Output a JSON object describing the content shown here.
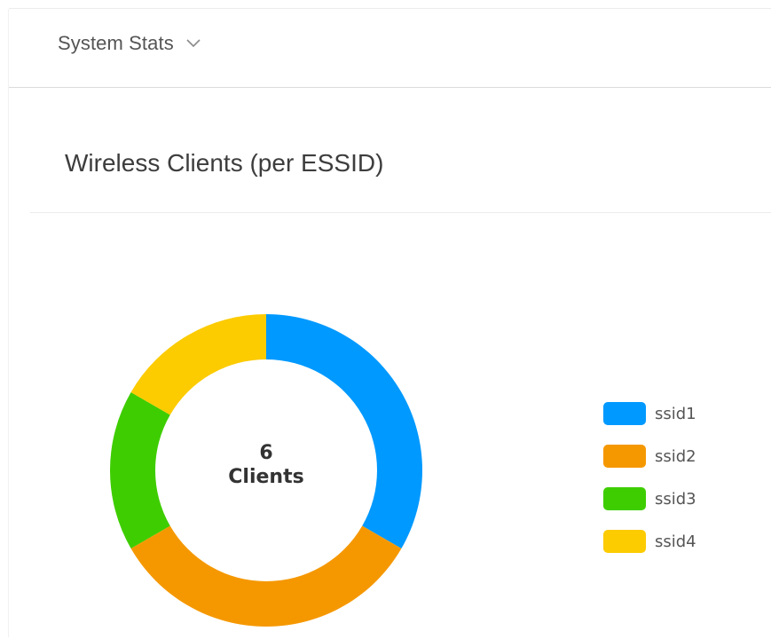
{
  "header": {
    "dropdown_label": "System Stats",
    "dropdown_icon": "chevron-down-icon"
  },
  "card": {
    "title": "Wireless Clients (per ESSID)",
    "center_count": "6",
    "center_label": "Clients"
  },
  "chart_data": {
    "type": "pie",
    "hole": true,
    "total": 6,
    "categories": [
      "ssid1",
      "ssid2",
      "ssid3",
      "ssid4"
    ],
    "values": [
      2,
      2,
      1,
      1
    ],
    "colors": [
      "#0099ff",
      "#f59800",
      "#3ecd00",
      "#fccb00"
    ],
    "legend_position": "right"
  }
}
